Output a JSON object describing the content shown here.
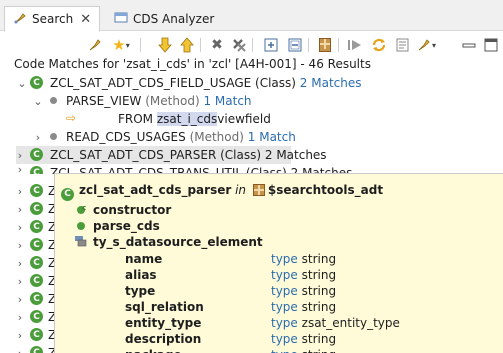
{
  "tabs": [
    {
      "label": "Search",
      "active": true
    },
    {
      "label": "CDS Analyzer",
      "active": false
    }
  ],
  "results_header": "Code Matches for 'zsat_i_cds' in 'zcl' [A4H-001] - 46 Results",
  "tree": {
    "row1": {
      "name": "ZCL_SAT_ADT_CDS_FIELD_USAGE",
      "type": "(Class)",
      "matches": "2 Matches"
    },
    "row2": {
      "name": "PARSE_VIEW",
      "type": "(Method)",
      "matches": "1 Match"
    },
    "row3": {
      "prefix": "FROM ",
      "highlight": "zsat_i_cds",
      "suffix": "viewfield"
    },
    "row4": {
      "name": "READ_CDS_USAGES",
      "type": "(Method)",
      "matches": "1 Match"
    },
    "row5": {
      "text": "ZCL_SAT_ADT_CDS_PARSER (Class) 2 Matches"
    },
    "row6": {
      "text": "ZCL_SAT_ADT_CDS_TRANS_UTIL (Class) 2 Matches"
    },
    "partial_rows": [
      "Z",
      "Z",
      "Z",
      "Z",
      "Z",
      "Z",
      "Z",
      "Z",
      "Z",
      "Z",
      "Z"
    ]
  },
  "popup": {
    "class_name": "zcl_sat_adt_cds_parser",
    "in_word": "in",
    "package": "$searchtools_adt",
    "members": [
      {
        "name": "constructor",
        "icon": "constructor-icon"
      },
      {
        "name": "parse_cds",
        "icon": "method-icon"
      },
      {
        "name": "ty_s_datasource_element",
        "icon": "type-icon"
      }
    ],
    "fields": [
      {
        "name": "name",
        "kw": "type",
        "type": "string"
      },
      {
        "name": "alias",
        "kw": "type",
        "type": "string"
      },
      {
        "name": "type",
        "kw": "type",
        "type": "string"
      },
      {
        "name": "sql_relation",
        "kw": "type",
        "type": "string"
      },
      {
        "name": "entity_type",
        "kw": "type",
        "type": "zsat_entity_type"
      },
      {
        "name": "description",
        "kw": "type",
        "type": "string"
      },
      {
        "name": "package",
        "kw": "type",
        "type": "string"
      }
    ]
  }
}
